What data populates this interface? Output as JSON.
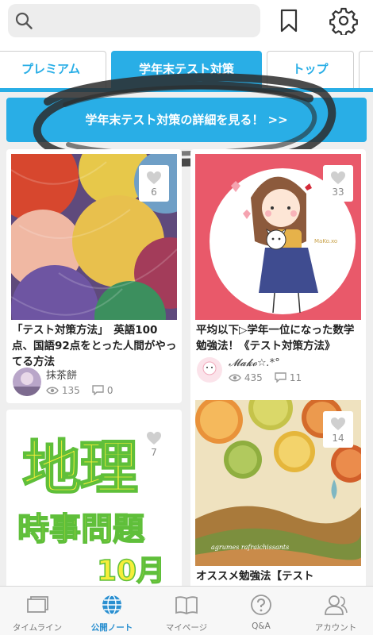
{
  "search": {
    "placeholder": "",
    "value": ""
  },
  "tabs": [
    {
      "label": "プレミアム"
    },
    {
      "label": "学年末テスト対策"
    },
    {
      "label": "トップ"
    }
  ],
  "banner": {
    "label": "学年末テスト対策の詳細を見る！ >>"
  },
  "cards": [
    {
      "likes": "6",
      "title": "「テスト対策方法」　英語100点、国語92点をとった人間がやってる方法",
      "author": "抹茶餅",
      "views": "135",
      "comments": "0"
    },
    {
      "likes": "33",
      "title": "平均以下▷学年一位になった数学勉強法！《テスト対策方法》",
      "author": "𝓜𝓪𝓴𝓸☆.*°",
      "views": "435",
      "comments": "11",
      "watermark": "MaKo.xo"
    },
    {
      "likes": "7",
      "image_text": {
        "line1": "地理",
        "line2": "時事問題",
        "line3": "10月"
      }
    },
    {
      "likes": "14",
      "title": "オススメ勉強法【テスト",
      "watermark": "agrumes rafraichissants"
    }
  ],
  "bottom_nav": [
    {
      "label": "タイムライン",
      "icon": "timeline-icon"
    },
    {
      "label": "公開ノート",
      "icon": "globe-icon"
    },
    {
      "label": "マイページ",
      "icon": "book-icon"
    },
    {
      "label": "Q&A",
      "icon": "question-icon"
    },
    {
      "label": "アカウント",
      "icon": "account-icon"
    }
  ],
  "colors": {
    "accent": "#29aee6",
    "nav_active": "#2a8fd0",
    "text": "#222222"
  }
}
